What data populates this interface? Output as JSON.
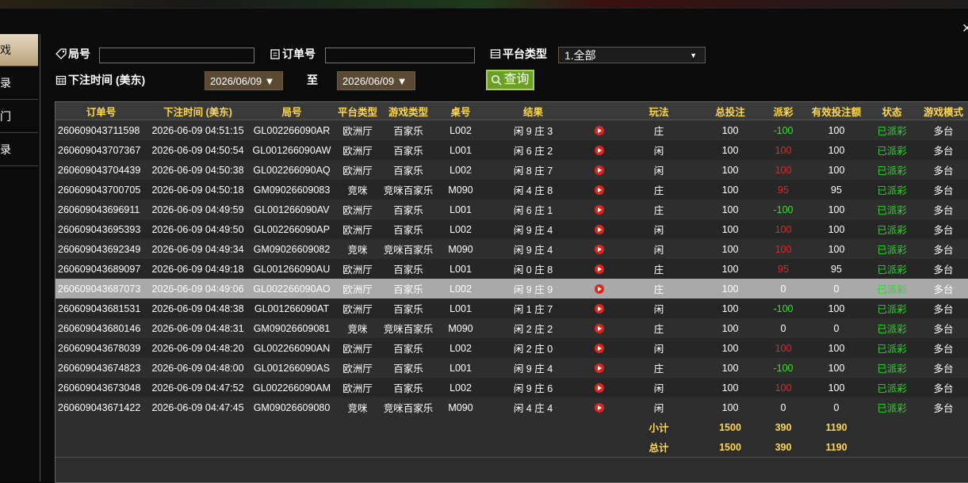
{
  "sidebar": [
    "戏",
    "录",
    "门",
    "录"
  ],
  "filters": {
    "order_game_label": "局号",
    "order_no_label": "订单号",
    "platform_label": "平台类型",
    "platform_value": "1.全部",
    "bet_time_label": "下注时间 (美东)",
    "date_from": "2026/06/09 ▼",
    "to_label": "至",
    "date_to": "2026/06/09 ▼",
    "query_label": "查询"
  },
  "columns": [
    "订单号",
    "下注时间 (美东)",
    "局号",
    "平台类型",
    "游戏类型",
    "桌号",
    "结果",
    "",
    "玩法",
    "总投注",
    "派彩",
    "有效投注额",
    "状态",
    "游戏模式"
  ],
  "rows": [
    [
      "260609043711598",
      "2026-06-09 04:51:15",
      "GL002266090AR",
      "欧洲厅",
      "百家乐",
      "L002",
      "闲 9 庄 3",
      "",
      "庄",
      "100",
      "-100",
      "100",
      "已派彩",
      "多台"
    ],
    [
      "260609043707367",
      "2026-06-09 04:50:54",
      "GL001266090AW",
      "欧洲厅",
      "百家乐",
      "L001",
      "闲 6 庄 2",
      "",
      "闲",
      "100",
      "100",
      "100",
      "已派彩",
      "多台"
    ],
    [
      "260609043704439",
      "2026-06-09 04:50:38",
      "GL002266090AQ",
      "欧洲厅",
      "百家乐",
      "L002",
      "闲 8 庄 7",
      "",
      "闲",
      "100",
      "100",
      "100",
      "已派彩",
      "多台"
    ],
    [
      "260609043700705",
      "2026-06-09 04:50:18",
      "GM09026609083",
      "竞咪",
      "竞咪百家乐",
      "M090",
      "闲 4 庄 8",
      "",
      "庄",
      "100",
      "95",
      "95",
      "已派彩",
      "多台"
    ],
    [
      "260609043696911",
      "2026-06-09 04:49:59",
      "GL001266090AV",
      "欧洲厅",
      "百家乐",
      "L001",
      "闲 6 庄 1",
      "",
      "庄",
      "100",
      "-100",
      "100",
      "已派彩",
      "多台"
    ],
    [
      "260609043695393",
      "2026-06-09 04:49:50",
      "GL002266090AP",
      "欧洲厅",
      "百家乐",
      "L002",
      "闲 9 庄 4",
      "",
      "闲",
      "100",
      "100",
      "100",
      "已派彩",
      "多台"
    ],
    [
      "260609043692349",
      "2026-06-09 04:49:34",
      "GM09026609082",
      "竞咪",
      "竞咪百家乐",
      "M090",
      "闲 9 庄 4",
      "",
      "闲",
      "100",
      "100",
      "100",
      "已派彩",
      "多台"
    ],
    [
      "260609043689097",
      "2026-06-09 04:49:18",
      "GL001266090AU",
      "欧洲厅",
      "百家乐",
      "L001",
      "闲 0 庄 8",
      "",
      "庄",
      "100",
      "95",
      "95",
      "已派彩",
      "多台"
    ],
    [
      "260609043687073",
      "2026-06-09 04:49:06",
      "GL002266090AO",
      "欧洲厅",
      "百家乐",
      "L002",
      "闲 9 庄 9",
      "",
      "庄",
      "100",
      "0",
      "0",
      "已派彩",
      "多台"
    ],
    [
      "260609043681531",
      "2026-06-09 04:48:38",
      "GL001266090AT",
      "欧洲厅",
      "百家乐",
      "L001",
      "闲 1 庄 7",
      "",
      "闲",
      "100",
      "-100",
      "100",
      "已派彩",
      "多台"
    ],
    [
      "260609043680146",
      "2026-06-09 04:48:31",
      "GM09026609081",
      "竞咪",
      "竞咪百家乐",
      "M090",
      "闲 2 庄 2",
      "",
      "庄",
      "100",
      "0",
      "0",
      "已派彩",
      "多台"
    ],
    [
      "260609043678039",
      "2026-06-09 04:48:20",
      "GL002266090AN",
      "欧洲厅",
      "百家乐",
      "L002",
      "闲 2 庄 0",
      "",
      "闲",
      "100",
      "100",
      "100",
      "已派彩",
      "多台"
    ],
    [
      "260609043674823",
      "2026-06-09 04:48:00",
      "GL001266090AS",
      "欧洲厅",
      "百家乐",
      "L001",
      "闲 9 庄 4",
      "",
      "庄",
      "100",
      "-100",
      "100",
      "已派彩",
      "多台"
    ],
    [
      "260609043673048",
      "2026-06-09 04:47:52",
      "GL002266090AM",
      "欧洲厅",
      "百家乐",
      "L002",
      "闲 9 庄 6",
      "",
      "闲",
      "100",
      "100",
      "100",
      "已派彩",
      "多台"
    ],
    [
      "260609043671422",
      "2026-06-09 04:47:45",
      "GM09026609080",
      "竞咪",
      "竞咪百家乐",
      "M090",
      "闲 4 庄 4",
      "",
      "闲",
      "100",
      "0",
      "0",
      "已派彩",
      "多台"
    ]
  ],
  "subtotal": {
    "label": "小计",
    "total_bet": "1500",
    "payout": "390",
    "valid_bet": "1190"
  },
  "total": {
    "label": "总计",
    "total_bet": "1500",
    "payout": "390",
    "valid_bet": "1190"
  },
  "colors": {
    "header_text": "#ffd84d",
    "negative": "#33e02a",
    "positive": "#e0262a",
    "status": "#22dd22"
  }
}
